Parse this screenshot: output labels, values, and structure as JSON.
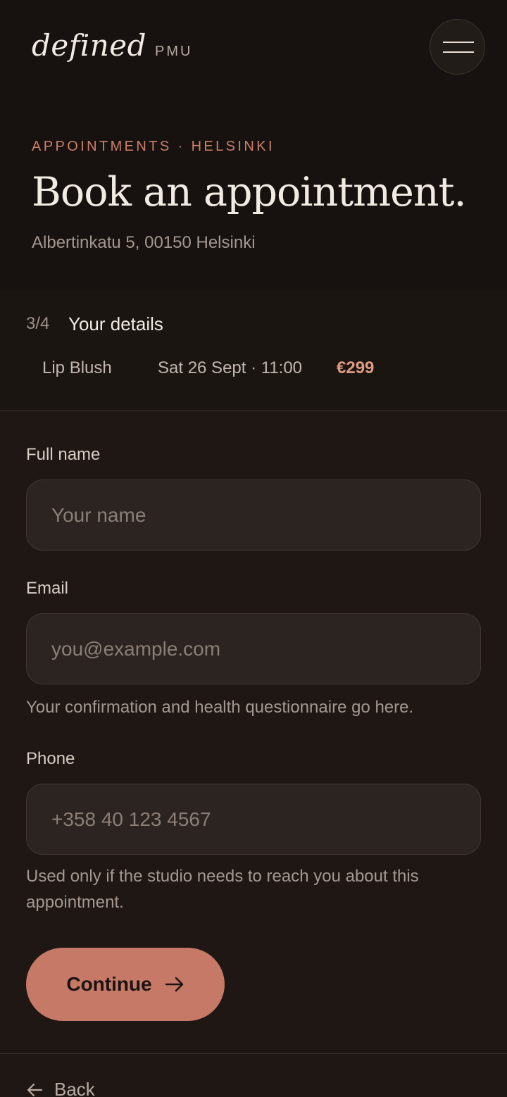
{
  "header": {
    "brand_name": "defined",
    "brand_sub": "PMU",
    "menu_icon": "hamburger-menu-icon"
  },
  "hero": {
    "eyebrow": "APPOINTMENTS · HELSINKI",
    "title": "Book an appointment.",
    "address": "Albertinkatu 5, 00150 Helsinki"
  },
  "summary": {
    "step": "3/4",
    "step_title": "Your details",
    "service": "Lip Blush",
    "slot": "Sat 26 Sept · 11:00",
    "price": "€299"
  },
  "form": {
    "name": {
      "label": "Full name",
      "placeholder": "Your name",
      "value": ""
    },
    "email": {
      "label": "Email",
      "placeholder": "you@example.com",
      "value": "",
      "hint": "Your confirmation and health questionnaire go here."
    },
    "phone": {
      "label": "Phone",
      "placeholder": "+358 40 123 4567",
      "value": "",
      "hint": "Used only if the studio needs to reach you about this appointment."
    },
    "continue_label": "Continue",
    "continue_icon": "arrow-right-icon"
  },
  "footer": {
    "back_label": "Back",
    "back_icon": "arrow-left-icon"
  },
  "colors": {
    "background": "#1e1714",
    "hero_background": "#171210",
    "accent": "#c67966",
    "price": "#e09a82",
    "eyebrow": "#cc7f69",
    "field_background": "#2b2420"
  }
}
